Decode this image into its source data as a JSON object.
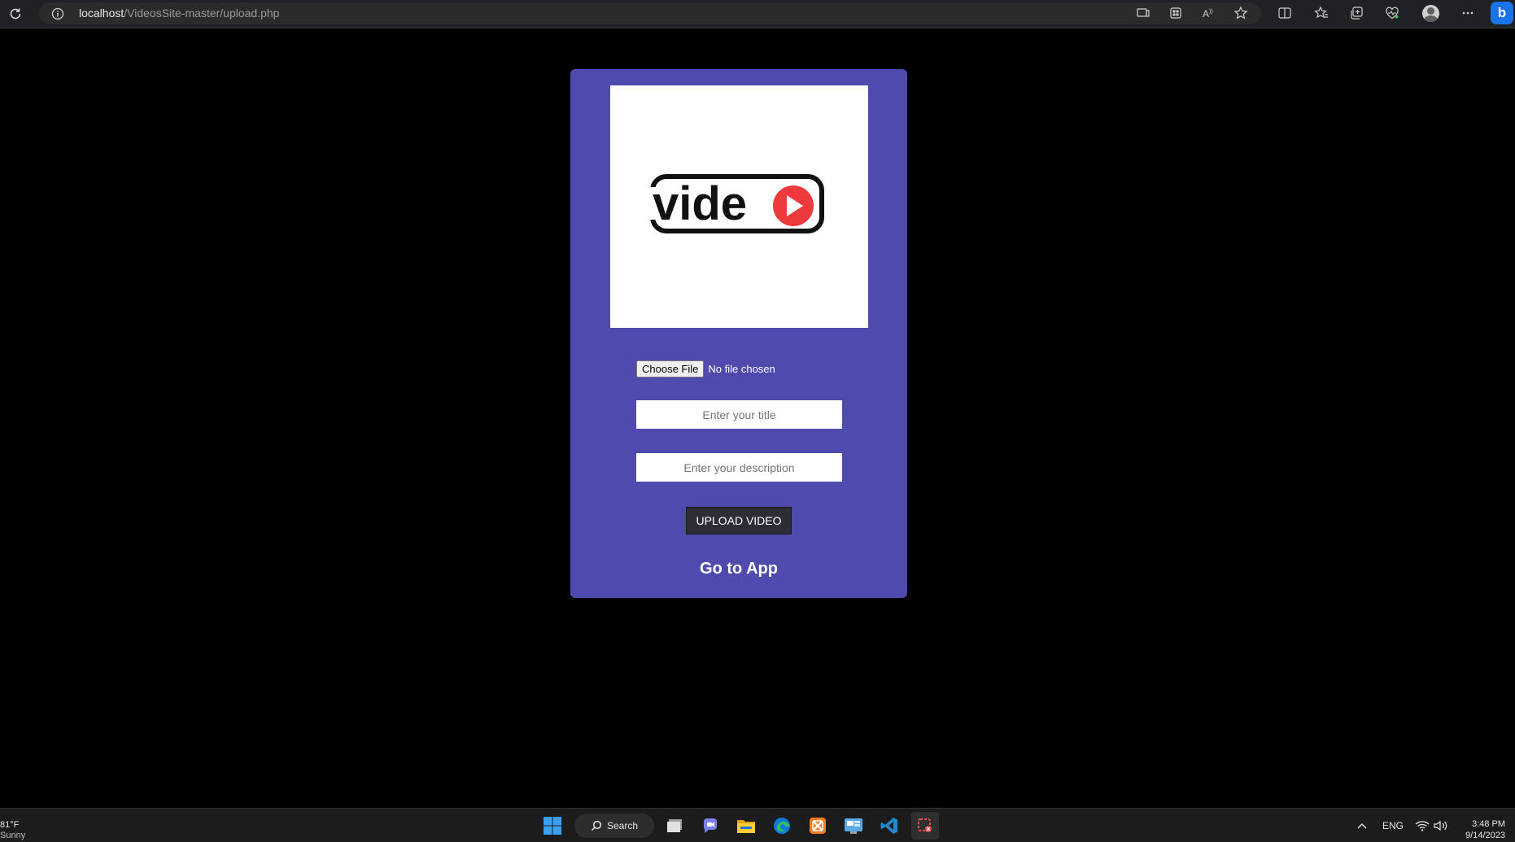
{
  "browser": {
    "url_host": "localhost",
    "url_path": "/VideosSite-master/upload.php",
    "icons": [
      "reload-icon",
      "site-info-icon",
      "immersive-reader-icon",
      "apps-icon",
      "read-aloud-icon",
      "favorite-star-icon",
      "split-screen-icon",
      "favorites-icon",
      "collections-icon",
      "browser-essentials-icon",
      "profile-icon",
      "more-icon",
      "copilot-icon"
    ],
    "copilot_letter": "b"
  },
  "page": {
    "logo_text": "vide",
    "file_input": {
      "button_label": "Choose File",
      "status": "No file chosen"
    },
    "title_input": {
      "placeholder": "Enter your title",
      "value": ""
    },
    "description_input": {
      "placeholder": "Enter your description",
      "value": ""
    },
    "upload_button_label": "UPLOAD VIDEO",
    "goto_app_label": "Go to App",
    "colors": {
      "background": "#000000",
      "card": "#4f4aad",
      "logo_accent": "#ee3a3d",
      "button": "#2d2d36"
    }
  },
  "taskbar": {
    "weather_temp": "81°F",
    "weather_condition": "Sunny",
    "search_label": "Search",
    "apps": [
      "windows-start-icon",
      "task-view-icon",
      "chat-icon",
      "file-explorer-icon",
      "edge-icon",
      "xampp-icon",
      "control-panel-icon",
      "vscode-icon",
      "snipping-tool-icon"
    ],
    "language": "ENG",
    "time": "3:48 PM",
    "date": "9/14/2023"
  }
}
